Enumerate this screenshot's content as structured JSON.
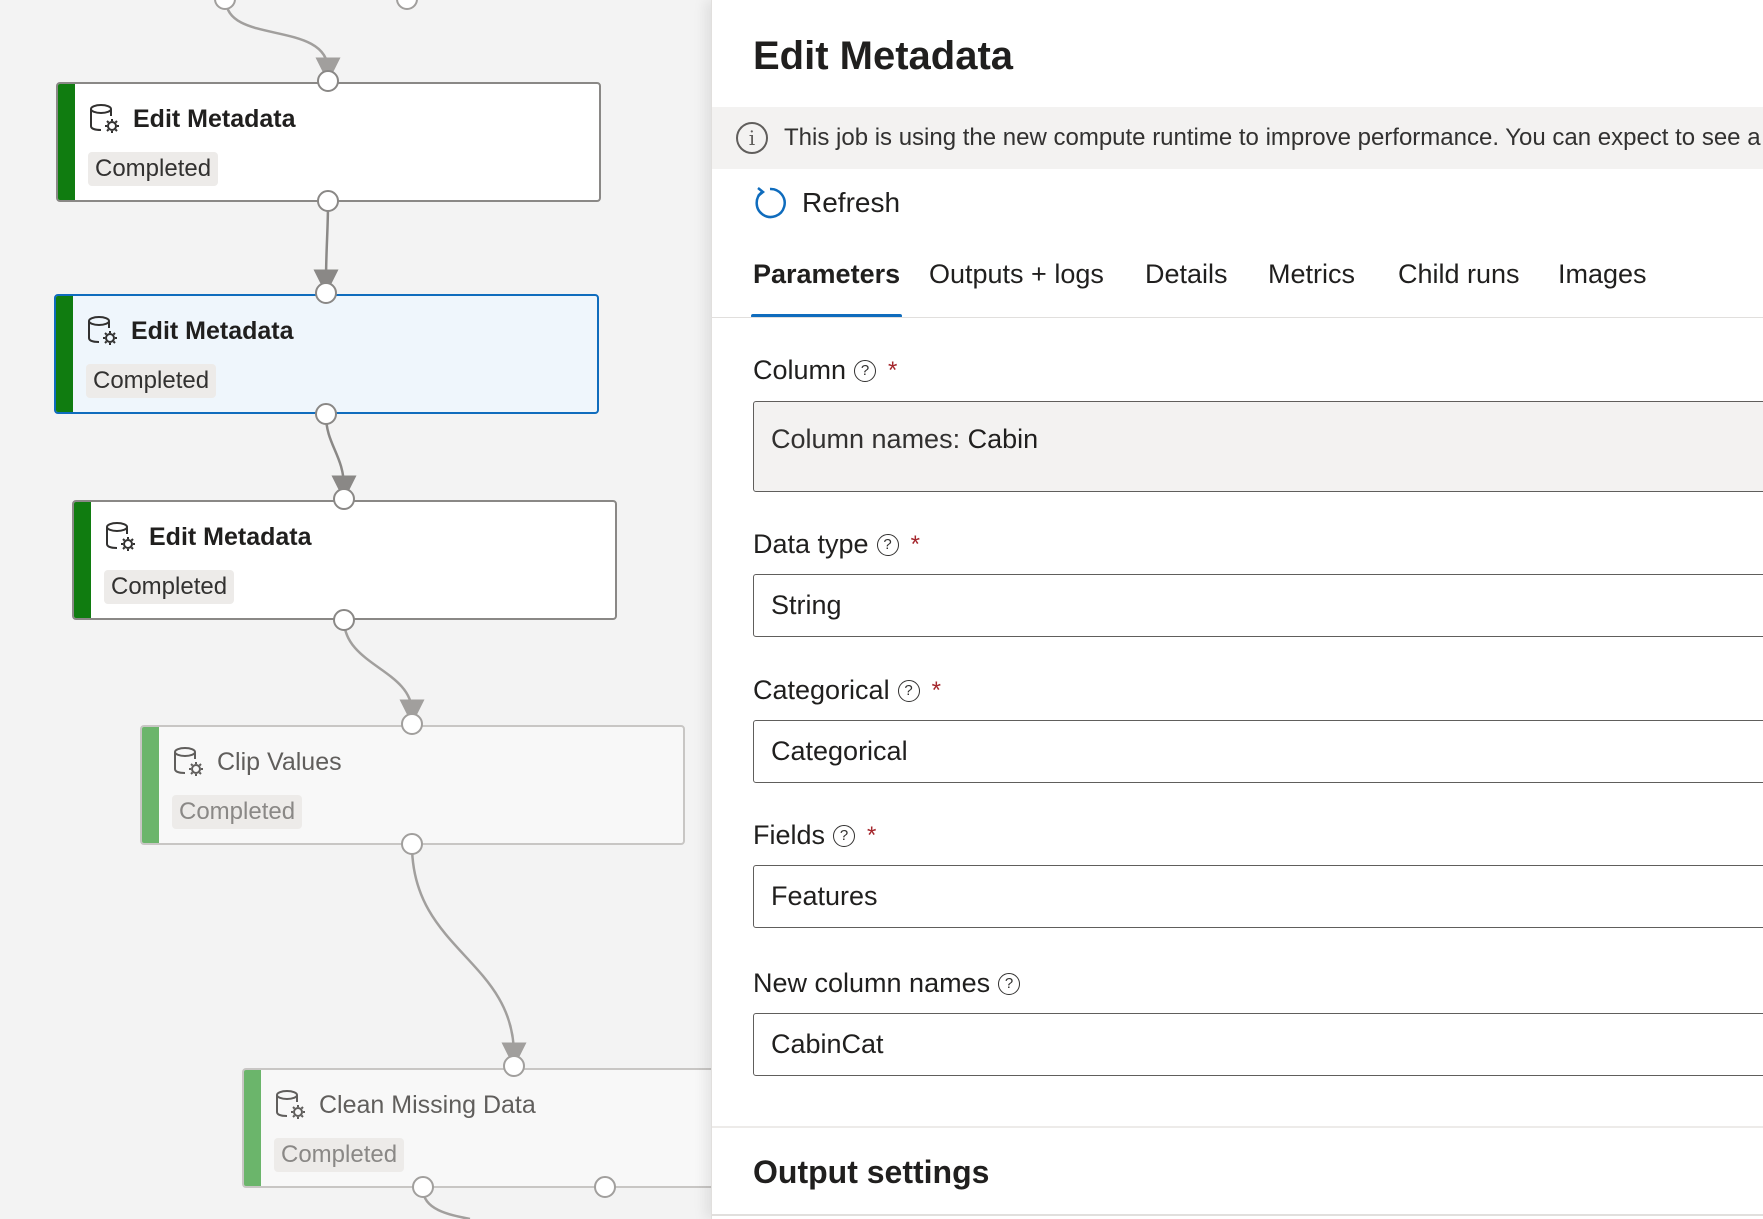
{
  "pipeline": {
    "nodes": [
      {
        "title": "Edit Metadata",
        "status": "Completed"
      },
      {
        "title": "Edit Metadata",
        "status": "Completed"
      },
      {
        "title": "Edit Metadata",
        "status": "Completed"
      },
      {
        "title": "Clip Values",
        "status": "Completed"
      },
      {
        "title": "Clean Missing Data",
        "status": "Completed"
      }
    ]
  },
  "panel": {
    "title": "Edit Metadata",
    "info_text": "This job is using the new compute runtime to improve performance. You can expect to see a",
    "info_icon": "info-icon",
    "refresh_label": "Refresh",
    "refresh_icon": "refresh-icon",
    "accent_color": "#0f6cbd",
    "tabs": [
      "Parameters",
      "Outputs + logs",
      "Details",
      "Metrics",
      "Child runs",
      "Images"
    ],
    "active_tab": "Parameters",
    "fields": {
      "column": {
        "label": "Column",
        "key": "Column names:",
        "value": "Cabin"
      },
      "data_type": {
        "label": "Data type",
        "value": "String"
      },
      "categorical": {
        "label": "Categorical",
        "value": "Categorical"
      },
      "fields": {
        "label": "Fields",
        "value": "Features"
      },
      "new_column_names": {
        "label": "New column names",
        "value": "CabinCat"
      }
    },
    "required_marker": "*",
    "help_glyph": "?",
    "output_settings_title": "Output settings"
  },
  "colors": {
    "completed_bar": "#107c10",
    "selected_border": "#0f6cbd",
    "required": "#a4262c"
  }
}
